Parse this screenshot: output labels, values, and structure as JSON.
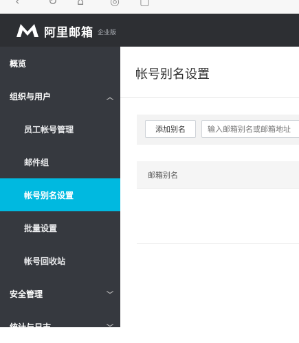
{
  "brand": {
    "name": "阿里邮箱",
    "edition": "企业版"
  },
  "sidebar": {
    "items": [
      {
        "label": "概览"
      },
      {
        "label": "组织与用户",
        "expanded": true
      },
      {
        "label": "员工帐号管理"
      },
      {
        "label": "邮件组"
      },
      {
        "label": "帐号别名设置",
        "active": true
      },
      {
        "label": "批量设置"
      },
      {
        "label": "帐号回收站"
      },
      {
        "label": "安全管理",
        "expanded": false
      },
      {
        "label": "统计与日志",
        "expanded": false
      }
    ]
  },
  "main": {
    "title": "帐号别名设置",
    "add_button": "添加别名",
    "search_placeholder": "输入邮箱别名或邮箱地址",
    "table": {
      "columns": [
        "邮箱别名"
      ]
    }
  },
  "colors": {
    "topbar": "#2d2f33",
    "sidebar": "#36393f",
    "active": "#00b9e0"
  }
}
